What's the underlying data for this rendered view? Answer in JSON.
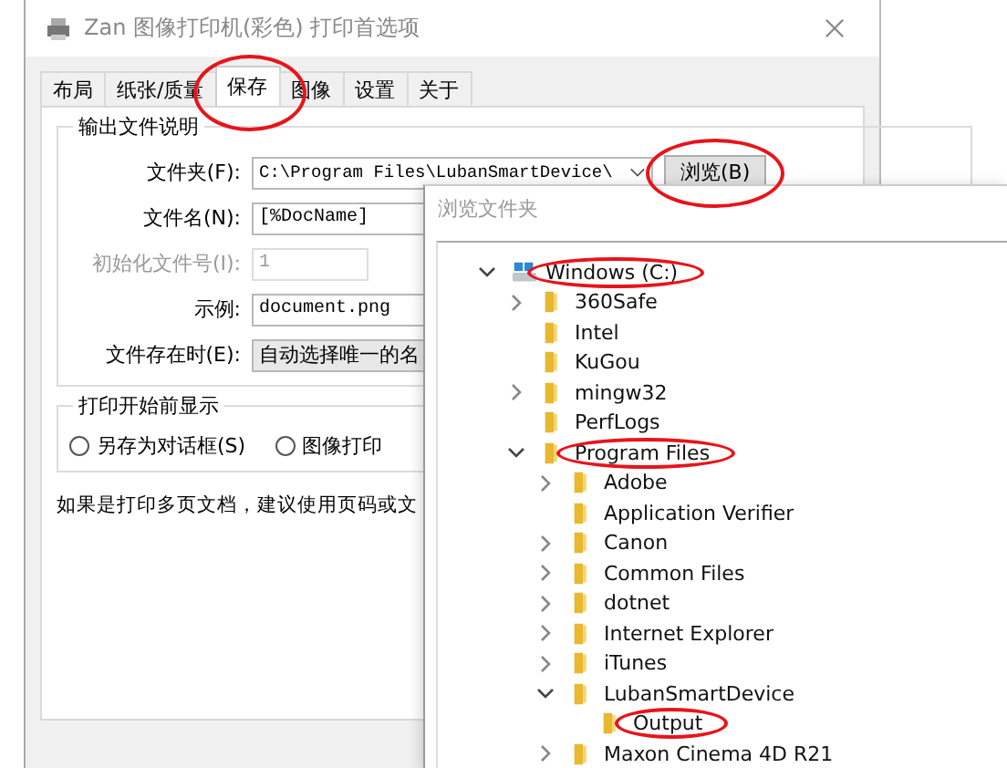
{
  "window": {
    "title": "Zan 图像打印机(彩色) 打印首选项"
  },
  "tabs": [
    {
      "label": "布局",
      "selected": false,
      "circled": false
    },
    {
      "label": "纸张/质量",
      "selected": false,
      "circled": false
    },
    {
      "label": "保存",
      "selected": true,
      "circled": true
    },
    {
      "label": "图像",
      "selected": false,
      "circled": false
    },
    {
      "label": "设置",
      "selected": false,
      "circled": false
    },
    {
      "label": "关于",
      "selected": false,
      "circled": false
    }
  ],
  "output_group": {
    "title": "输出文件说明",
    "rows": [
      {
        "label": "文件夹(F):",
        "kind": "combo",
        "value": "C:\\Program Files\\LubanSmartDevice\\",
        "disabled": false,
        "button": {
          "label": "浏览(B)",
          "circled": true
        }
      },
      {
        "label": "文件名(N):",
        "kind": "field",
        "value": "[%DocName]",
        "disabled": false
      },
      {
        "label": "初始化文件号(I):",
        "kind": "small",
        "value": "1",
        "disabled": true
      },
      {
        "label": "示例:",
        "kind": "field",
        "value": "document.png",
        "disabled": false
      },
      {
        "label": "文件存在时(E):",
        "kind": "dropdown",
        "value": "自动选择唯一的名",
        "disabled": false
      }
    ]
  },
  "show_group": {
    "title": "打印开始前显示",
    "options": [
      {
        "label": "另存为对话框(S)",
        "selected": false
      },
      {
        "label": "图像打印",
        "selected": false
      }
    ]
  },
  "note": "如果是打印多页文档，建议使用页码或文",
  "browse_dialog": {
    "title": "浏览文件夹",
    "tree": [
      {
        "label": "Windows (C:)",
        "kind": "drive",
        "expandable": true,
        "expanded": true,
        "circled": true,
        "children": [
          {
            "label": "360Safe",
            "kind": "folder",
            "expandable": true,
            "expanded": false,
            "circled": false
          },
          {
            "label": "Intel",
            "kind": "folder",
            "expandable": false,
            "circled": false
          },
          {
            "label": "KuGou",
            "kind": "folder",
            "expandable": false,
            "circled": false
          },
          {
            "label": "mingw32",
            "kind": "folder",
            "expandable": true,
            "expanded": false,
            "circled": false
          },
          {
            "label": "PerfLogs",
            "kind": "folder",
            "expandable": false,
            "circled": false
          },
          {
            "label": "Program Files",
            "kind": "folder",
            "expandable": true,
            "expanded": true,
            "circled": true,
            "children": [
              {
                "label": "Adobe",
                "kind": "folder",
                "expandable": true,
                "expanded": false,
                "circled": false
              },
              {
                "label": "Application Verifier",
                "kind": "folder",
                "expandable": false,
                "circled": false
              },
              {
                "label": "Canon",
                "kind": "folder",
                "expandable": true,
                "expanded": false,
                "circled": false
              },
              {
                "label": "Common Files",
                "kind": "folder",
                "expandable": true,
                "expanded": false,
                "circled": false
              },
              {
                "label": "dotnet",
                "kind": "folder",
                "expandable": true,
                "expanded": false,
                "circled": false
              },
              {
                "label": "Internet Explorer",
                "kind": "folder",
                "expandable": true,
                "expanded": false,
                "circled": false
              },
              {
                "label": "iTunes",
                "kind": "folder",
                "expandable": true,
                "expanded": false,
                "circled": false
              },
              {
                "label": "LubanSmartDevice",
                "kind": "folder",
                "expandable": true,
                "expanded": true,
                "circled": false,
                "children": [
                  {
                    "label": "Output",
                    "kind": "folder",
                    "expandable": false,
                    "circled": true
                  }
                ]
              },
              {
                "label": "Maxon Cinema 4D R21",
                "kind": "folder",
                "expandable": true,
                "expanded": false,
                "circled": false
              }
            ]
          }
        ]
      }
    ]
  }
}
